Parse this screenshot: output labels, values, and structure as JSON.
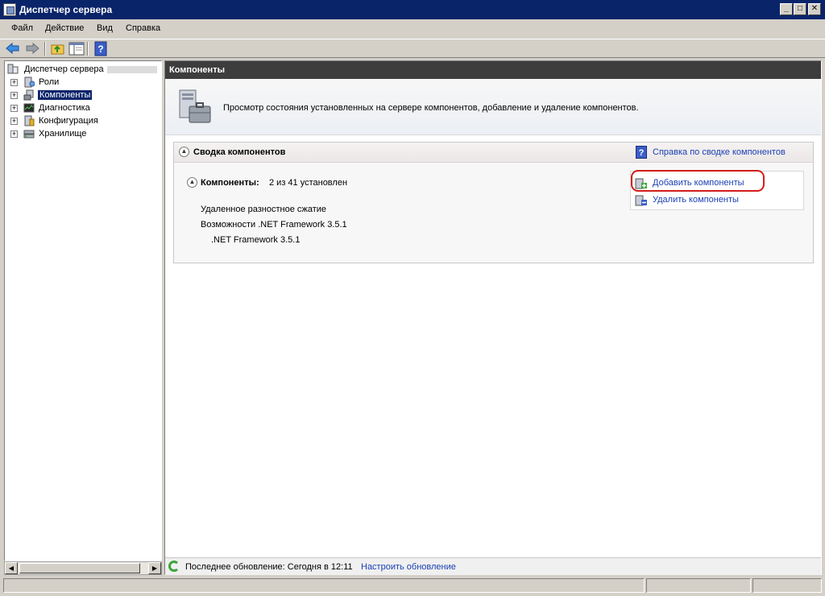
{
  "window": {
    "title": "Диспетчер сервера",
    "buttons": {
      "minimize": "_",
      "maximize": "□",
      "close": "✕"
    }
  },
  "menu": {
    "file": "Файл",
    "action": "Действие",
    "view": "Вид",
    "help": "Справка"
  },
  "tree": {
    "root": "Диспетчер сервера",
    "items": [
      {
        "label": "Роли"
      },
      {
        "label": "Компоненты"
      },
      {
        "label": "Диагностика"
      },
      {
        "label": "Конфигурация"
      },
      {
        "label": "Хранилище"
      }
    ],
    "expander": "+"
  },
  "content": {
    "header": "Компоненты",
    "description": "Просмотр состояния установленных на сервере компонентов, добавление и удаление компонентов.",
    "summary": {
      "title": "Сводка компонентов",
      "help_link": "Справка по сводке компонентов",
      "help_icon": "?",
      "components_label": "Компоненты:",
      "components_count": "2 из 41 установлен",
      "installed": [
        "Удаленное разностное сжатие",
        "Возможности .NET Framework 3.5.1",
        ".NET Framework 3.5.1"
      ],
      "actions": {
        "add": "Добавить компоненты",
        "remove": "Удалить компоненты"
      }
    },
    "footer": {
      "last_update": "Последнее обновление: Сегодня в 12:11",
      "configure_link": "Настроить обновление"
    }
  },
  "colors": {
    "title_bar": "#0a246a",
    "content_header": "#3d3d3d",
    "link": "#1a3fb4",
    "highlight": "#d41c1c"
  }
}
